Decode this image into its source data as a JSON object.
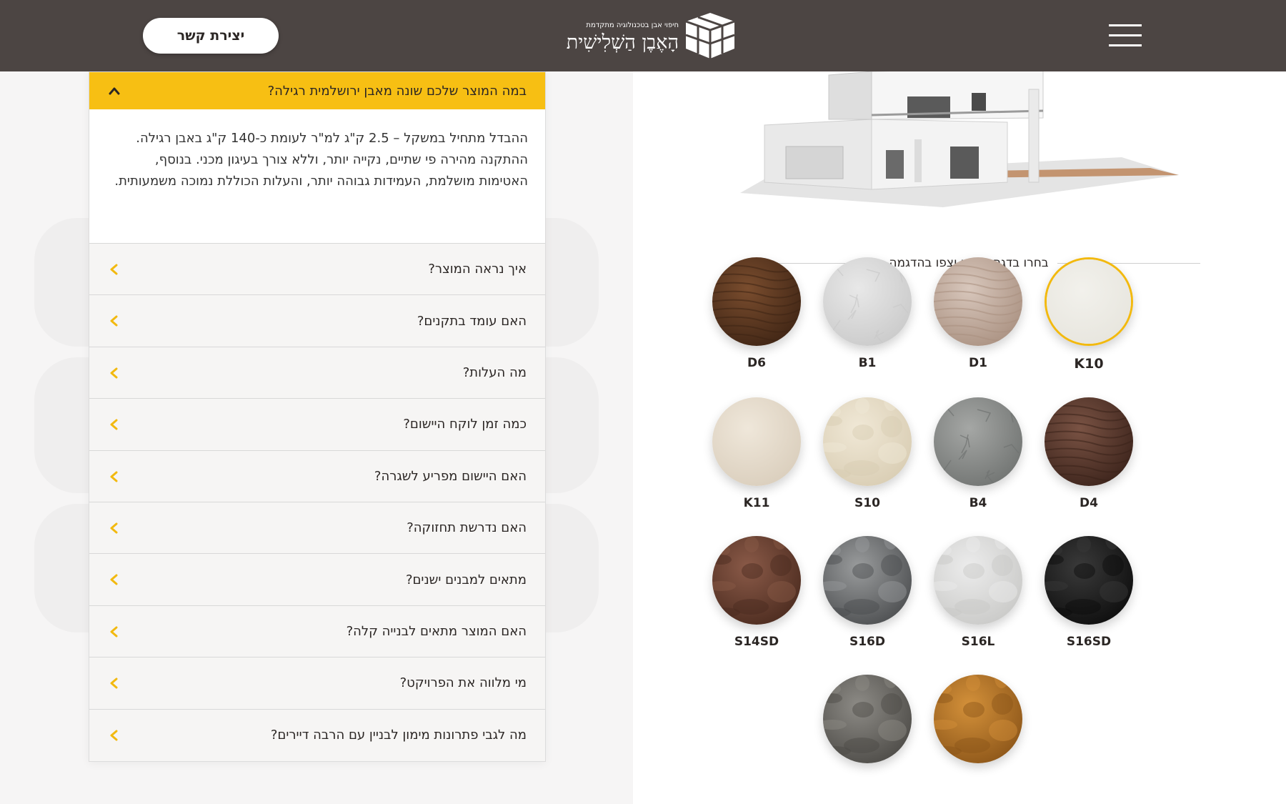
{
  "header": {
    "contact_button": "יצירת קשר",
    "logo_tagline": "חיפוי אבן בטכנולוגיה מתקדמת",
    "logo_name": "הָאֶבֶן הַשְׁלִישִׁית",
    "menu_icon": "hamburger-icon"
  },
  "faq": {
    "open_item": {
      "question": "במה המוצר שלכם שונה מאבן ירושלמית רגילה?",
      "answer": "ההבדל מתחיל במשקל – 2.5 ק\"ג למ\"ר לעומת כ-140 ק\"ג באבן רגילה. ההתקנה מהירה פי שתיים, נקייה יותר, וללא צורך בעיגון מכני. בנוסף, האטימות מושלמת, העמידות גבוהה יותר, והעלות הכוללת נמוכה משמעותית."
    },
    "items": [
      {
        "question": "איך נראה המוצר?"
      },
      {
        "question": "האם עומד בתקנים?"
      },
      {
        "question": "מה העלות?"
      },
      {
        "question": "כמה זמן לוקח היישום?"
      },
      {
        "question": "האם היישום מפריע לשגרה?"
      },
      {
        "question": "האם נדרשת תחזוקה?"
      },
      {
        "question": "מתאים למבנים ישנים?"
      },
      {
        "question": "האם המוצר מתאים לבנייה קלה?"
      },
      {
        "question": "מי מלווה את הפרויקט?"
      },
      {
        "question": "מה לגבי פתרונות מימון לבניין עם הרבה דיירים?"
      }
    ]
  },
  "samples": {
    "title": "בחרו בדגם הרצוי וצפו בהדגמה",
    "selected": "K10",
    "items": [
      {
        "code": "K10",
        "colors": [
          "#f2f1ec",
          "#e6e4dc"
        ],
        "texture": "smooth"
      },
      {
        "code": "D1",
        "colors": [
          "#d8c7bc",
          "#a99080"
        ],
        "texture": "wood"
      },
      {
        "code": "B1",
        "colors": [
          "#e8e8e8",
          "#c9c9c9"
        ],
        "texture": "crinkle"
      },
      {
        "code": "D6",
        "colors": [
          "#7a4d2e",
          "#3e2414"
        ],
        "texture": "wood"
      },
      {
        "code": "D4",
        "colors": [
          "#7a5344",
          "#3a221a"
        ],
        "texture": "wood"
      },
      {
        "code": "B4",
        "colors": [
          "#a5a7a5",
          "#6f7270"
        ],
        "texture": "crinkle"
      },
      {
        "code": "S10",
        "colors": [
          "#f0e8d6",
          "#d8ccb2"
        ],
        "texture": "stone"
      },
      {
        "code": "K11",
        "colors": [
          "#efe7da",
          "#d9cdbb"
        ],
        "texture": "smooth"
      },
      {
        "code": "S16SD",
        "colors": [
          "#3a3a3a",
          "#0c0c0c"
        ],
        "texture": "stone"
      },
      {
        "code": "S16L",
        "colors": [
          "#ececec",
          "#c8c8c6"
        ],
        "texture": "stone"
      },
      {
        "code": "S16D",
        "colors": [
          "#9a9c9d",
          "#4a4c4e"
        ],
        "texture": "stone"
      },
      {
        "code": "S14SD",
        "colors": [
          "#8a5a48",
          "#4a2a1e"
        ],
        "texture": "stone"
      },
      {
        "code": "",
        "colors": [
          "#d4913a",
          "#8a5418"
        ],
        "texture": "stone"
      },
      {
        "code": "",
        "colors": [
          "#8d8b86",
          "#4b4945"
        ],
        "texture": "stone"
      }
    ]
  }
}
